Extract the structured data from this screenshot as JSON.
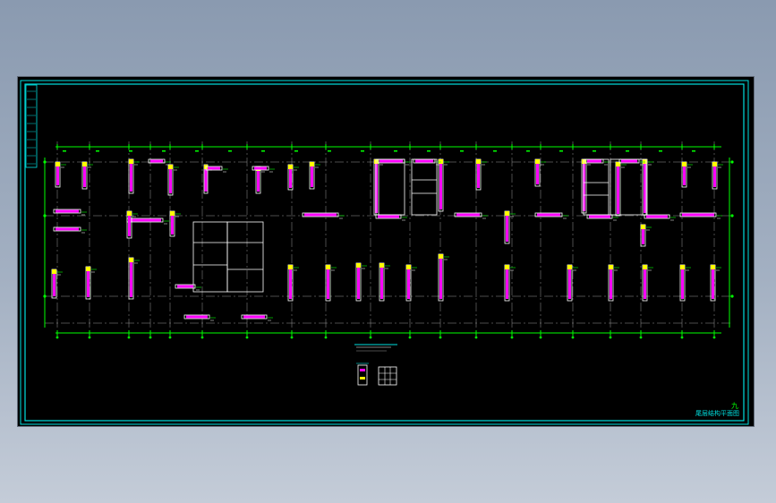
{
  "drawing": {
    "title_block_label": "尾层结构平面图",
    "sheet_number": "九",
    "colors": {
      "background": "#000000",
      "frame": "#00e0e0",
      "axis": "#00ff00",
      "wall": "#ffffff",
      "rebar": "#ff00ff",
      "highlight": "#ffff00",
      "grey": "#9a9a9a"
    }
  }
}
